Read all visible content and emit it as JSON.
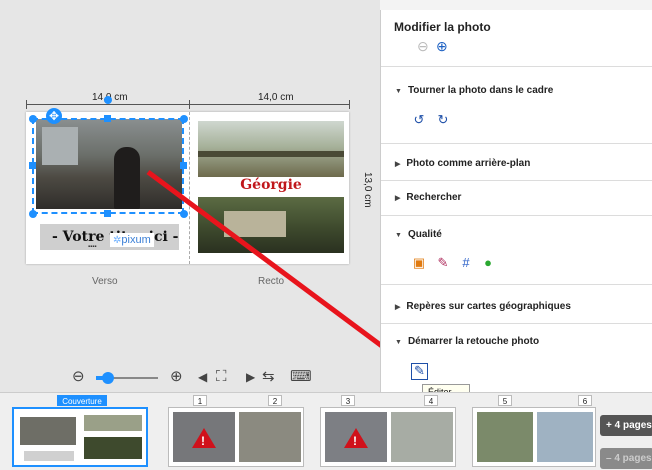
{
  "canvas": {
    "dim_left": "14,0 cm",
    "dim_right": "14,0 cm",
    "dim_height": "13,0 cm",
    "page_verso": "Verso",
    "page_recto": "Recto",
    "cover_title": "- Votre titre ici -",
    "cover_georgie": "Géorgie",
    "logo_pixum": "pixum",
    "arrow_color": "#e8141c"
  },
  "panel": {
    "title": "Modifier la photo",
    "sections": [
      {
        "label": "Tourner la photo dans le cadre",
        "expanded": true
      },
      {
        "label": "Photo comme arrière-plan",
        "expanded": false
      },
      {
        "label": "Rechercher",
        "expanded": false
      },
      {
        "label": "Qualité",
        "expanded": true
      },
      {
        "label": "Repères sur cartes géographiques",
        "expanded": false
      },
      {
        "label": "Démarrer la retouche photo",
        "expanded": true
      }
    ],
    "tooltip": "Éditer..."
  },
  "strip": {
    "cover_label": "Couverture",
    "page_numbers": [
      "1",
      "2",
      "3",
      "4",
      "5",
      "6"
    ],
    "add_pages_label": "+ 4 pages",
    "remove_pages_label": "– 4 pages"
  },
  "colors": {
    "accent": "#1e90ff",
    "warning": "#d0111b"
  },
  "icons": [
    "zoom-out-icon",
    "zoom-in-icon",
    "rotate-left-icon",
    "rotate-right-icon",
    "auto-enhance-icon",
    "brush-icon",
    "grid-icon",
    "red-eye-icon",
    "edit-photo-icon",
    "warning-icon"
  ]
}
